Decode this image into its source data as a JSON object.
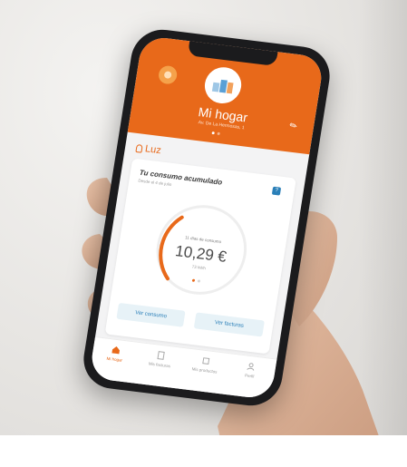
{
  "app": {
    "brand_color": "#e8691a",
    "accent_color": "#2a7fb8"
  },
  "header": {
    "home_title": "Mi hogar",
    "address": "Av. De La Hermosas, 1",
    "edit_icon": "pencil-icon"
  },
  "supply": {
    "label": "Luz",
    "icon": "lightbulb-icon"
  },
  "consumption_card": {
    "title": "Tu consumo acumulado",
    "subtitle": "Desde el 4 de julio",
    "days_text": "11 días de consumo",
    "amount": "10,29 €",
    "kwh": "73 kWh",
    "view_consumption_label": "Ver consumo",
    "view_invoices_label": "Ver facturas"
  },
  "nav": {
    "items": [
      {
        "label": "Mi hogar",
        "icon": "home-icon",
        "active": true
      },
      {
        "label": "Mis facturas",
        "icon": "invoice-icon",
        "active": false
      },
      {
        "label": "Mis productos",
        "icon": "products-icon",
        "active": false
      },
      {
        "label": "Perfil",
        "icon": "profile-icon",
        "active": false
      }
    ]
  }
}
